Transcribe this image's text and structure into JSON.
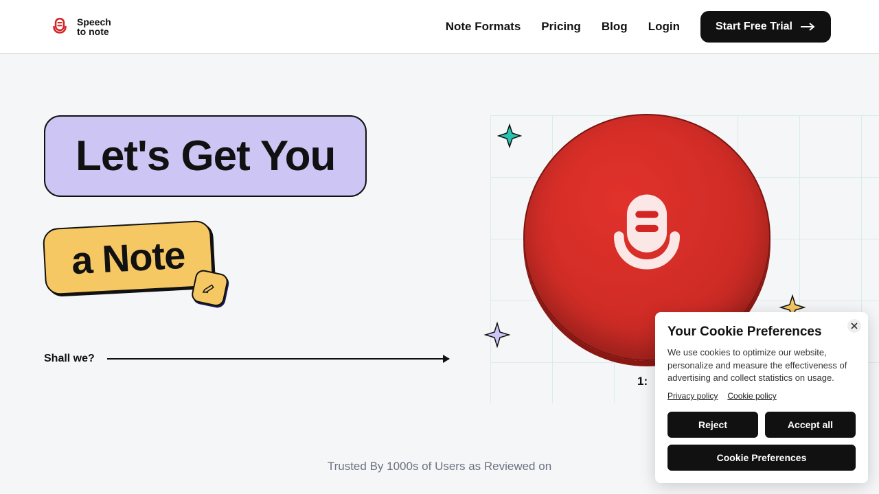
{
  "brand": {
    "name_line1": "Speech",
    "name_line2": "to note"
  },
  "nav": {
    "items": [
      "Note Formats",
      "Pricing",
      "Blog",
      "Login"
    ],
    "cta": "Start Free Trial"
  },
  "hero": {
    "line1": "Let's Get You",
    "line2": "a Note",
    "shall": "Shall we?",
    "time_partial": "1:"
  },
  "trusted": "Trusted By 1000s of Users as Reviewed on",
  "cookie": {
    "title": "Your Cookie Preferences",
    "body": "We use cookies to optimize our website, personalize and measure the effectiveness of advertising and collect statistics on usage.",
    "privacy": "Privacy policy",
    "policy": "Cookie policy",
    "reject": "Reject",
    "accept": "Accept all",
    "prefs": "Cookie Preferences"
  },
  "colors": {
    "brand_red": "#d42424",
    "purple": "#cdc5f4",
    "yellow": "#f6c864",
    "teal": "#28c3b0"
  }
}
